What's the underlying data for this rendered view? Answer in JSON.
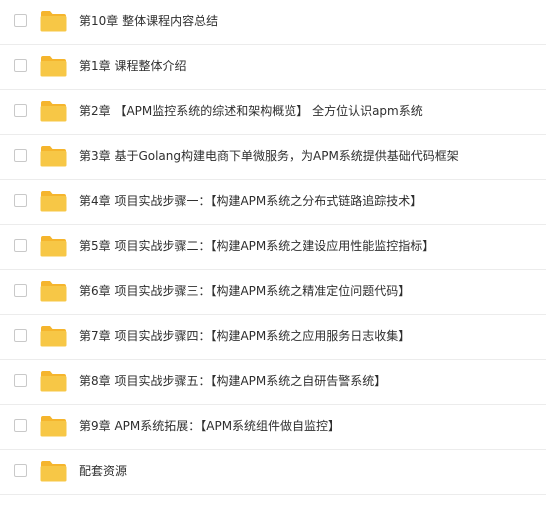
{
  "colors": {
    "folder_body": "#f7c746",
    "folder_tab": "#f5b52d",
    "text": "#2e2e2e",
    "divider": "#ececec",
    "checkbox_border": "#c9c9c9"
  },
  "items": [
    {
      "name": "第10章 整体课程内容总结",
      "icon": "folder-icon"
    },
    {
      "name": "第1章 课程整体介绍",
      "icon": "folder-icon"
    },
    {
      "name": "第2章 【APM监控系统的综述和架构概览】 全方位认识apm系统",
      "icon": "folder-icon"
    },
    {
      "name": "第3章 基于Golang构建电商下单微服务，为APM系统提供基础代码框架",
      "icon": "folder-icon"
    },
    {
      "name": "第4章 项目实战步骤一：【构建APM系统之分布式链路追踪技术】",
      "icon": "folder-icon"
    },
    {
      "name": "第5章 项目实战步骤二：【构建APM系统之建设应用性能监控指标】",
      "icon": "folder-icon"
    },
    {
      "name": "第6章 项目实战步骤三：【构建APM系统之精准定位问题代码】",
      "icon": "folder-icon"
    },
    {
      "name": "第7章 项目实战步骤四：【构建APM系统之应用服务日志收集】",
      "icon": "folder-icon"
    },
    {
      "name": "第8章 项目实战步骤五：【构建APM系统之自研告警系统】",
      "icon": "folder-icon"
    },
    {
      "name": "第9章 APM系统拓展：【APM系统组件做自监控】",
      "icon": "folder-icon"
    },
    {
      "name": "配套资源",
      "icon": "folder-icon"
    }
  ]
}
